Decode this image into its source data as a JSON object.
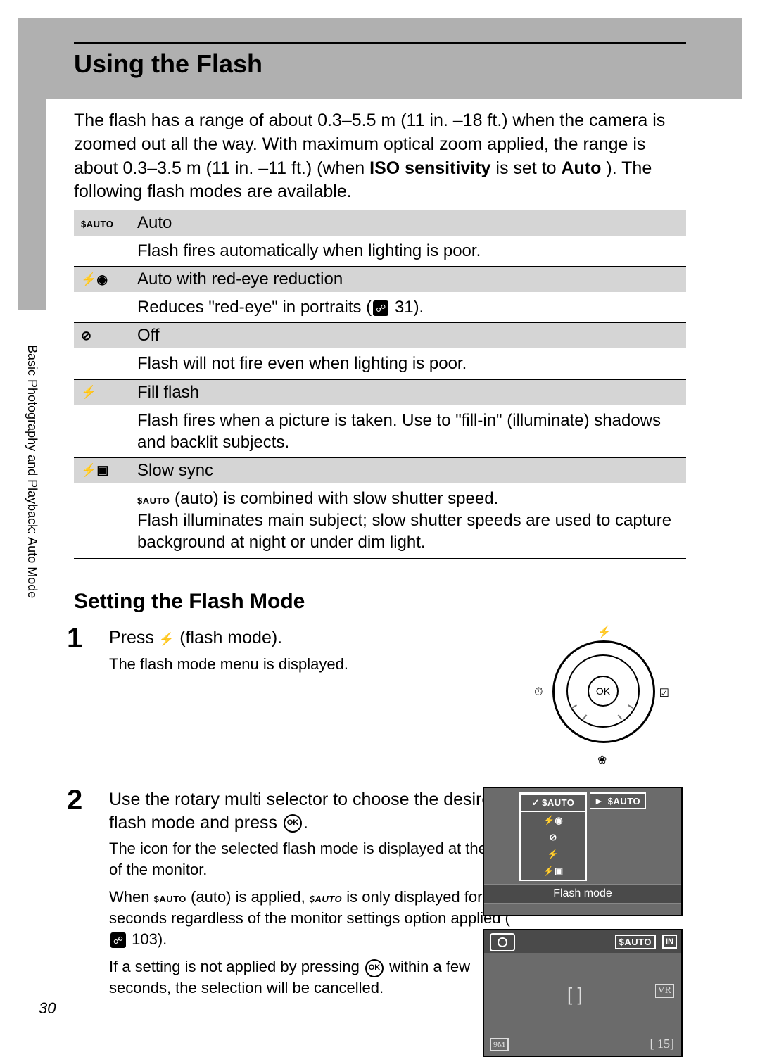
{
  "page_number": "30",
  "side_label": "Basic Photography and Playback: Auto Mode",
  "title": "Using the Flash",
  "intro": {
    "part1": "The flash has a range of about 0.3–5.5 m (11 in. –18 ft.) when the camera is zoomed out all the way. With maximum optical zoom applied, the range is about 0.3–3.5 m (11 in. –11 ft.) (when ",
    "bold1": "ISO sensitivity",
    "part2": " is set to ",
    "bold2": "Auto",
    "part3": "). The following flash modes are available."
  },
  "modes": [
    {
      "icon": "$AUTO",
      "name": "Auto",
      "desc_pre": "Flash fires automatically when lighting is poor.",
      "ref": "",
      "desc_post": ""
    },
    {
      "icon": "⚡◉",
      "name": "Auto with red-eye reduction",
      "desc_pre": "Reduces \"red-eye\" in portraits (",
      "ref": "31",
      "desc_post": ")."
    },
    {
      "icon": "⊘",
      "name": "Off",
      "desc_pre": "Flash will not fire even when lighting is poor.",
      "ref": "",
      "desc_post": ""
    },
    {
      "icon": "⚡",
      "name": "Fill flash",
      "desc_pre": "Flash fires when a picture is taken. Use to \"fill-in\" (illuminate) shadows and backlit subjects.",
      "ref": "",
      "desc_post": ""
    },
    {
      "icon": "⚡▣",
      "name": "Slow sync",
      "desc_pre": "",
      "ref": "",
      "desc_post": ""
    }
  ],
  "slow_sync": {
    "lead_icon": "$AUTO",
    "lead": " (auto) is combined with slow shutter speed.",
    "rest": "Flash illuminates main subject; slow shutter speeds are used to capture background at night or under dim light."
  },
  "section2_title": "Setting the Flash Mode",
  "step1": {
    "num": "1",
    "title_pre": "Press ",
    "title_icon": "⚡",
    "title_post": " (flash mode).",
    "body": "The flash mode menu is displayed."
  },
  "dial": {
    "ok": "OK",
    "top": "⚡",
    "bottom": "❀",
    "left": "⏱",
    "right": "☑"
  },
  "step2": {
    "num": "2",
    "title_pre": "Use the rotary multi selector to choose the desired flash mode and press ",
    "title_ok": "OK",
    "title_post": ".",
    "p1": "The icon for the selected flash mode is displayed at the top of the monitor.",
    "p2_pre": "When ",
    "p2_icon1": "$AUTO",
    "p2_mid": " (auto) is applied, ",
    "p2_icon2": "$AUTO",
    "p2_post": " is only displayed for a few seconds regardless of the monitor settings option applied (",
    "p2_ref": "103",
    "p2_end": ").",
    "p3_pre": "If a setting is not applied by pressing ",
    "p3_ok": "OK",
    "p3_post": " within a few seconds, the selection will be cancelled."
  },
  "monitor1": {
    "options": [
      "$AUTO",
      "⚡◉",
      "⊘",
      "⚡",
      "⚡▣"
    ],
    "side_tag": "$AUTO",
    "caption": "Flash mode"
  },
  "monitor2": {
    "auto_tag": "$AUTO",
    "in_tag": "IN",
    "vr": "VR",
    "mp": "9M",
    "shots": "[   15]",
    "brackets": "[   ]"
  }
}
